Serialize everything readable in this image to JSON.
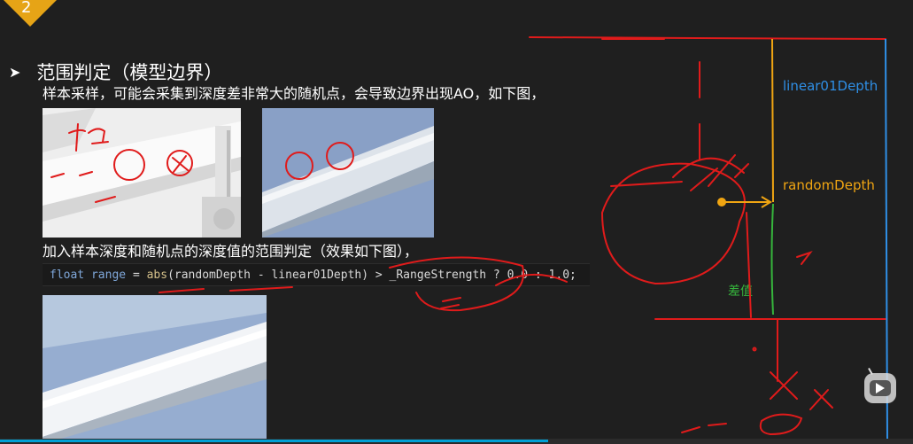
{
  "slide": {
    "number": "2"
  },
  "heading": {
    "bullet": "➤",
    "title": "范围判定（模型边界）"
  },
  "desc": "样本采样，可能会采集到深度差非常大的随机点，会导致边界出现AO，如下图，",
  "desc2": "加入样本深度和随机点的深度值的范围判定（效果如下图），",
  "code": {
    "kw1": "float",
    "var": " range ",
    "eq": "= ",
    "fn": "abs",
    "rest": "(randomDepth - linear01Depth) > _RangeStrength ? 0.0 : 1.0;"
  },
  "annotations": {
    "linear": "linear01Depth",
    "random": "randomDepth",
    "diff": "差值"
  },
  "colors": {
    "accent": "#e6a416",
    "blue": "#2f8fe6",
    "orange": "#f0a512",
    "green": "#36b53c",
    "ink": "#e01b1b"
  },
  "player": {
    "progress": 0.6,
    "icon": "bilibili-icon"
  }
}
